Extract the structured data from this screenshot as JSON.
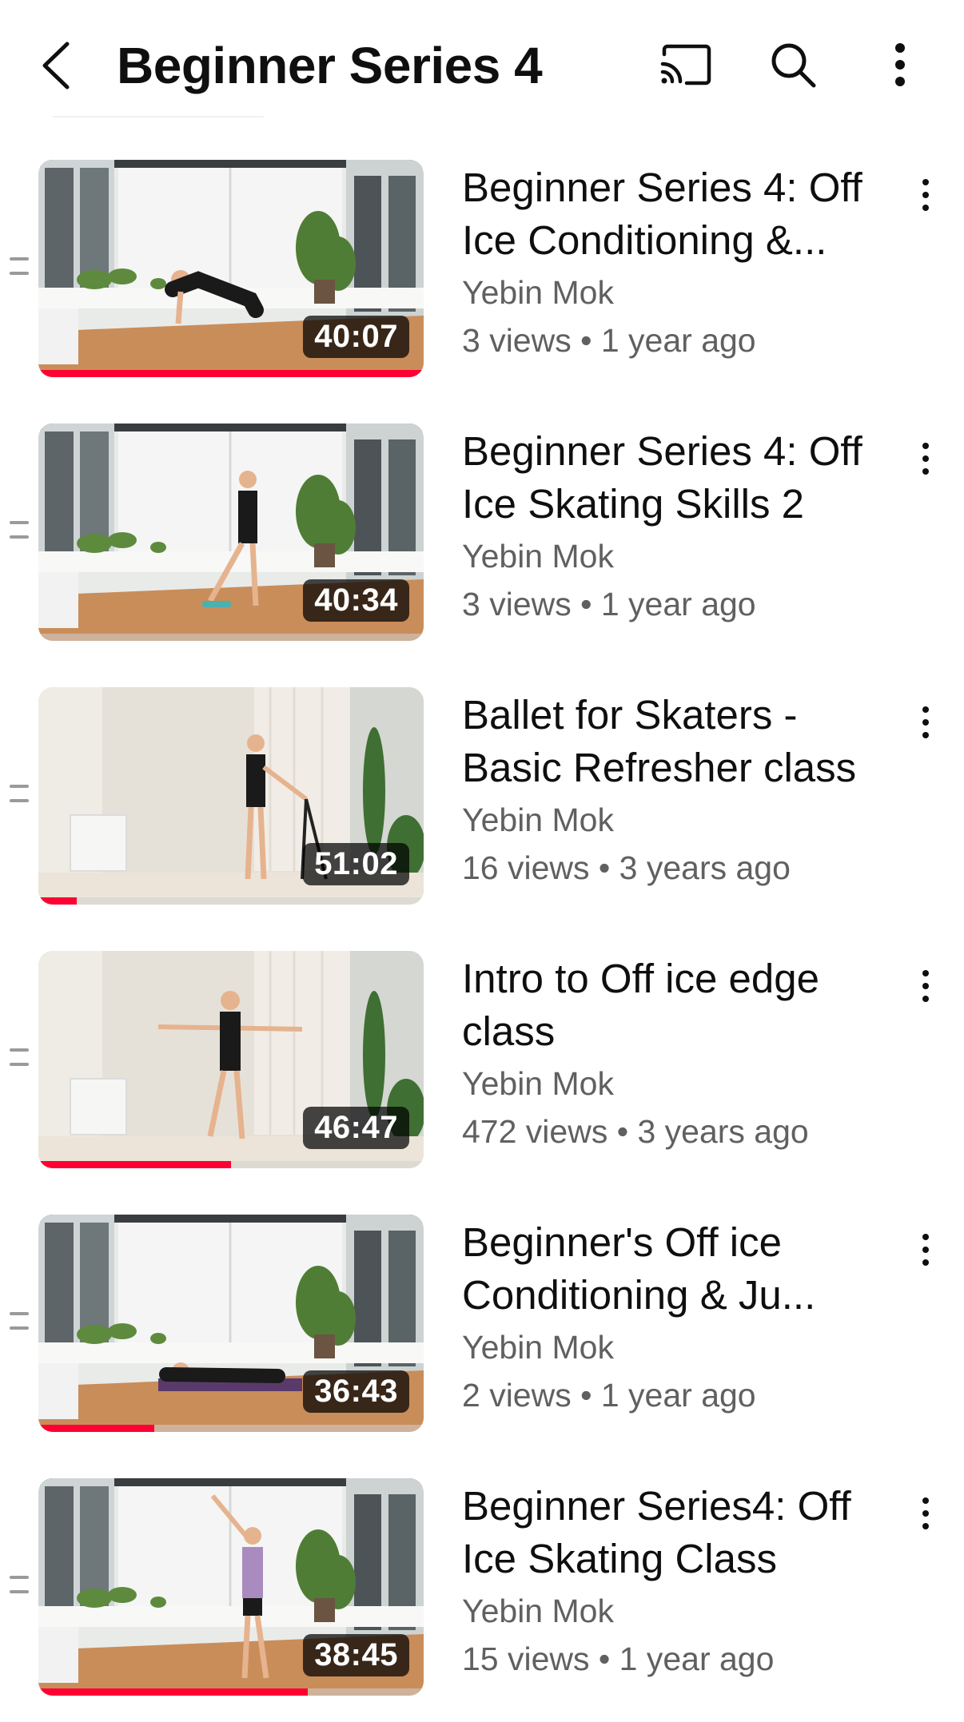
{
  "header": {
    "title": "Beginner Series 4",
    "icons": [
      "back-icon",
      "cast-icon",
      "search-icon",
      "more-vert-icon"
    ]
  },
  "colors": {
    "progress": "#ff0033",
    "text_primary": "#0f0f0f",
    "text_secondary": "#606060"
  },
  "videos": [
    {
      "title": "Beginner Series 4: Off Ice Conditioning &...",
      "channel": "Yebin Mok",
      "meta": "3 views • 1 year ago",
      "duration": "40:07",
      "progress": 1.0,
      "scene": "conservatory-plank"
    },
    {
      "title": "Beginner Series 4: Off Ice Skating Skills 2",
      "channel": "Yebin Mok",
      "meta": "3 views • 1 year ago",
      "duration": "40:34",
      "progress": 0.0,
      "scene": "conservatory-standing"
    },
    {
      "title": "Ballet for Skaters - Basic Refresher class",
      "channel": "Yebin Mok",
      "meta": "16 views • 3 years ago",
      "duration": "51:02",
      "progress": 0.1,
      "scene": "studio-barre"
    },
    {
      "title": "Intro to Off ice edge class",
      "channel": "Yebin Mok",
      "meta": "472 views • 3 years ago",
      "duration": "46:47",
      "progress": 0.5,
      "scene": "studio-arms"
    },
    {
      "title": "Beginner's Off ice Conditioning & Ju...",
      "channel": "Yebin Mok",
      "meta": "2 views • 1 year ago",
      "duration": "36:43",
      "progress": 0.3,
      "scene": "conservatory-floor"
    },
    {
      "title": "Beginner Series4: Off Ice Skating Class",
      "channel": "Yebin Mok",
      "meta": "15 views • 1 year ago",
      "duration": "38:45",
      "progress": 0.7,
      "scene": "conservatory-pose"
    }
  ]
}
